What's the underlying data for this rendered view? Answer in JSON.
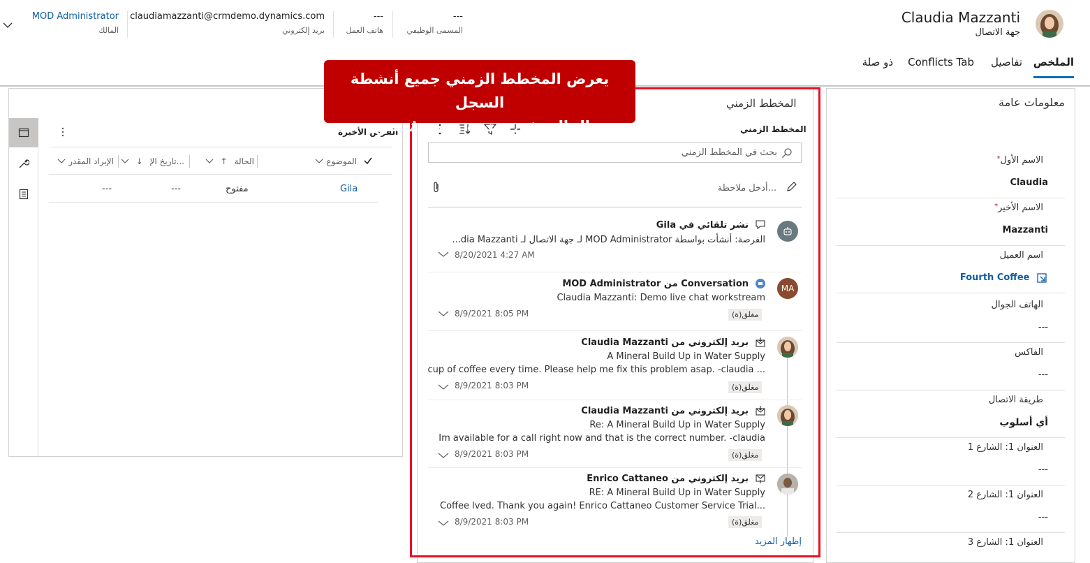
{
  "header": {
    "record_name": "Claudia Mazzanti",
    "entity": "جهة الاتصال",
    "fields": [
      {
        "value": "---",
        "label": "المسمى الوظيفي"
      },
      {
        "value": "---",
        "label": "هاتف العمل"
      },
      {
        "value": "claudiamazzanti@crmdemo.dynamics.com",
        "label": "بريد إلكتروني"
      },
      {
        "value": "MOD Administrator",
        "label": "المالك"
      }
    ],
    "expand_icon": "chevron-down-icon"
  },
  "tabs": [
    {
      "label": "الملخص",
      "active": true
    },
    {
      "label": "تفاصيل"
    },
    {
      "label": "Conflicts Tab"
    },
    {
      "label": "ذو صلة"
    }
  ],
  "callout": {
    "line1": "يعرض المخطط الزمني جميع أنشطة السجل",
    "line2": "الحالي في ترتيب زمني مُنسق."
  },
  "general": {
    "title": "معلومات عامة",
    "fields": [
      {
        "label": "الاسم الأول",
        "value": "Claudia",
        "required": true
      },
      {
        "label": "الاسم الأخير",
        "value": "Mazzanti",
        "required": true
      },
      {
        "label": "اسم العميل",
        "value": "Fourth Coffee",
        "link": true
      },
      {
        "label": "الهاتف الجوال",
        "value": "---"
      },
      {
        "label": "الفاكس",
        "value": "---"
      },
      {
        "label": "طريقة الاتصال",
        "value": "أي أسلوب"
      },
      {
        "label": "العنوان 1: الشارع 1",
        "value": "---"
      },
      {
        "label": "العنوان 1: الشارع 2",
        "value": "---"
      },
      {
        "label": "العنوان 1: الشارع 3",
        "value": ""
      }
    ]
  },
  "timeline": {
    "section_title": "المخطط الزمني",
    "sub_title": "المخطط الزمني",
    "search_placeholder": "بحث في المخطط الزمني",
    "note_placeholder": "أدخل ملاحظة...",
    "show_more": "إظهار المزيد",
    "activities": [
      {
        "title": "نشر تلقائي في Gila",
        "line1": "الفرصة: أنشأت بواسطة MOD Administrator لـ جهة الاتصال لـ dia Mazzanti...",
        "line2": "",
        "date": "8/20/2021 4:27 AM",
        "badge": "",
        "avatar": "bot",
        "type_icon": "post-icon"
      },
      {
        "title": "Conversation من MOD Administrator",
        "line1": "Claudia Mazzanti: Demo live chat workstream",
        "line2": "",
        "date": "8/9/2021 8:05 PM",
        "badge": "مغلق(ة)",
        "avatar": "MA",
        "type_icon": "conversation-icon"
      },
      {
        "title": "بريد إلكتروني من Claudia Mazzanti",
        "line1": "A Mineral Build Up in Water Supply",
        "line2": "cup of coffee every time.  Please help me fix this problem asap. -claudia ...",
        "date": "8/9/2021 8:03 PM",
        "badge": "مغلق(ة)",
        "avatar": "photo-claudia",
        "type_icon": "email-received-icon"
      },
      {
        "title": "بريد إلكتروني من Claudia Mazzanti",
        "line1": "Re: A Mineral Build Up in Water Supply",
        "line2": "Im available for a call right now and that is the correct number. -claudia",
        "date": "8/9/2021 8:03 PM",
        "badge": "مغلق(ة)",
        "avatar": "photo-claudia",
        "type_icon": "email-received-icon"
      },
      {
        "title": "بريد إلكتروني من Enrico Cattaneo",
        "line1": "RE: A Mineral Build Up in Water Supply",
        "line2": "Coffee     lved. Thank you again! Enrico Cattaneo Customer Service Trial...",
        "date": "8/9/2021 8:03 PM",
        "badge": "مغلق(ة)",
        "avatar": "photo-enrico",
        "type_icon": "email-sent-icon"
      }
    ]
  },
  "opportunities": {
    "title": "الفرص الأخيرة",
    "columns": [
      "الموضوع",
      "الحالة",
      "تاريخ الإ...",
      "الإيراد المقدر"
    ],
    "rows": [
      {
        "subject": "Gila",
        "status": "مفتوح",
        "date": "---",
        "revenue": "---"
      }
    ]
  },
  "colors": {
    "accent": "#0f6cbd",
    "callout": "#c00000",
    "highlight_border": "#e81123"
  }
}
